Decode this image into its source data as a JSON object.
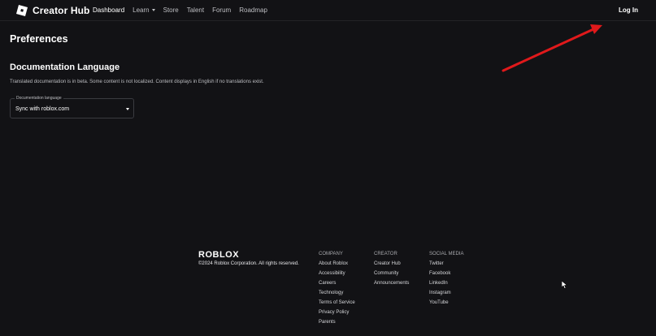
{
  "header": {
    "brand": "Creator Hub",
    "nav": [
      {
        "label": "Dashboard",
        "active": true
      },
      {
        "label": "Learn",
        "dropdown": true
      },
      {
        "label": "Store"
      },
      {
        "label": "Talent"
      },
      {
        "label": "Forum"
      },
      {
        "label": "Roadmap"
      }
    ],
    "login_label": "Log In"
  },
  "main": {
    "page_title": "Preferences",
    "section_title": "Documentation Language",
    "section_description": "Translated documentation is in beta. Some content is not localized. Content displays in English if no translations exist.",
    "language_select": {
      "label": "Documentation language",
      "value": "Sync with roblox.com"
    }
  },
  "footer": {
    "wordmark": "ROBLOX",
    "copyright": "©2024 Roblox Corporation. All rights reserved.",
    "columns": {
      "company": {
        "title": "COMPANY",
        "links": [
          "About Roblox",
          "Accessibility",
          "Careers",
          "Technology",
          "Terms of Service",
          "Privacy Policy",
          "Parents"
        ]
      },
      "creator": {
        "title": "CREATOR",
        "links": [
          "Creator Hub",
          "Community",
          "Announcements"
        ]
      },
      "social": {
        "title": "SOCIAL MEDIA",
        "links": [
          "Twitter",
          "Facebook",
          "LinkedIn",
          "Instagram",
          "YouTube"
        ]
      }
    }
  },
  "colors": {
    "background": "#121215",
    "annotation_arrow": "#e0191b"
  },
  "icons": {
    "brand_logo": "roblox-creator-hub-logo",
    "annotation": "red-arrow-pointing-to-login",
    "cursor": "mouse-pointer"
  }
}
